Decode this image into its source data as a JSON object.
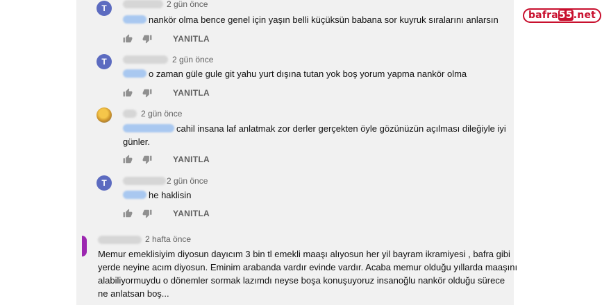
{
  "logo": {
    "part1": "bafra",
    "part2": "55",
    "part3": ".net"
  },
  "reply_label": "YANITLA",
  "comments": [
    {
      "avatar_letter": "T",
      "time": "2 gün önce",
      "text": "nankör olma bence genel için yaşın belli küçüksün babana sor kuyruk sıralarını anlarsın"
    },
    {
      "avatar_letter": "T",
      "time": "2 gün önce",
      "text": "o zaman güle gule git yahu yurt dışına tutan yok boş yorum yapma nankör olma"
    },
    {
      "avatar_letter": "",
      "time": "2 gün önce",
      "text_line1": "cahil insana laf anlatmak zor derler gerçekten öyle gözünüzün açılması dileğiyle iyi",
      "text_line2": "günler."
    },
    {
      "avatar_letter": "T",
      "time": "2 gün önce",
      "text": "he haklisin"
    }
  ],
  "top_comment": {
    "time": "2 hafta önce",
    "lines": [
      "Memur emeklisiyim diyosun dayıcım 3 bin tl emekli maaşı alıyosun her yil bayram ikramiyesi , bafra gibi",
      "yerde neyine acım diyosun. Eminim arabanda vardır  evinde vardır.  Acaba memur olduğu yıllarda maaşını",
      "alabiliyormuydu o dönemler sormak lazımdı neyse boşa konuşuyoruz insanoğlu  nankör olduğu sürece",
      "ne anlatsan boş..."
    ]
  }
}
